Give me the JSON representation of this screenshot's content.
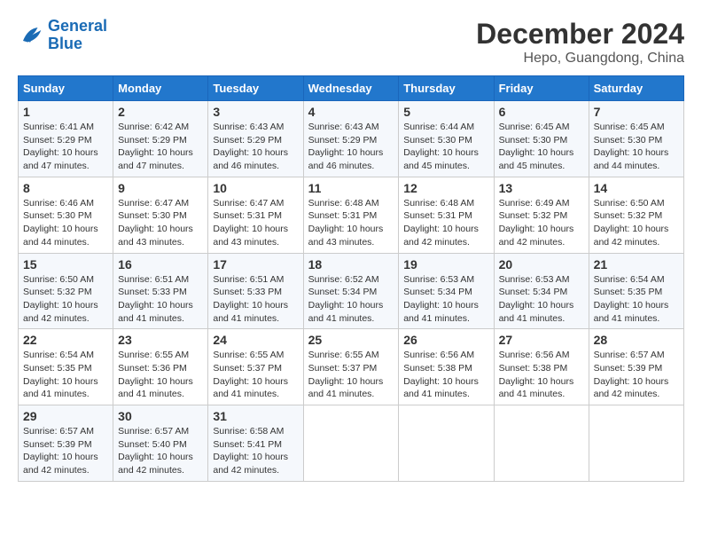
{
  "logo": {
    "line1": "General",
    "line2": "Blue"
  },
  "title": "December 2024",
  "location": "Hepo, Guangdong, China",
  "header": {
    "days": [
      "Sunday",
      "Monday",
      "Tuesday",
      "Wednesday",
      "Thursday",
      "Friday",
      "Saturday"
    ]
  },
  "weeks": [
    [
      {
        "day": "1",
        "sunrise": "6:41 AM",
        "sunset": "5:29 PM",
        "daylight": "10 hours and 47 minutes."
      },
      {
        "day": "2",
        "sunrise": "6:42 AM",
        "sunset": "5:29 PM",
        "daylight": "10 hours and 47 minutes."
      },
      {
        "day": "3",
        "sunrise": "6:43 AM",
        "sunset": "5:29 PM",
        "daylight": "10 hours and 46 minutes."
      },
      {
        "day": "4",
        "sunrise": "6:43 AM",
        "sunset": "5:29 PM",
        "daylight": "10 hours and 46 minutes."
      },
      {
        "day": "5",
        "sunrise": "6:44 AM",
        "sunset": "5:30 PM",
        "daylight": "10 hours and 45 minutes."
      },
      {
        "day": "6",
        "sunrise": "6:45 AM",
        "sunset": "5:30 PM",
        "daylight": "10 hours and 45 minutes."
      },
      {
        "day": "7",
        "sunrise": "6:45 AM",
        "sunset": "5:30 PM",
        "daylight": "10 hours and 44 minutes."
      }
    ],
    [
      {
        "day": "8",
        "sunrise": "6:46 AM",
        "sunset": "5:30 PM",
        "daylight": "10 hours and 44 minutes."
      },
      {
        "day": "9",
        "sunrise": "6:47 AM",
        "sunset": "5:30 PM",
        "daylight": "10 hours and 43 minutes."
      },
      {
        "day": "10",
        "sunrise": "6:47 AM",
        "sunset": "5:31 PM",
        "daylight": "10 hours and 43 minutes."
      },
      {
        "day": "11",
        "sunrise": "6:48 AM",
        "sunset": "5:31 PM",
        "daylight": "10 hours and 43 minutes."
      },
      {
        "day": "12",
        "sunrise": "6:48 AM",
        "sunset": "5:31 PM",
        "daylight": "10 hours and 42 minutes."
      },
      {
        "day": "13",
        "sunrise": "6:49 AM",
        "sunset": "5:32 PM",
        "daylight": "10 hours and 42 minutes."
      },
      {
        "day": "14",
        "sunrise": "6:50 AM",
        "sunset": "5:32 PM",
        "daylight": "10 hours and 42 minutes."
      }
    ],
    [
      {
        "day": "15",
        "sunrise": "6:50 AM",
        "sunset": "5:32 PM",
        "daylight": "10 hours and 42 minutes."
      },
      {
        "day": "16",
        "sunrise": "6:51 AM",
        "sunset": "5:33 PM",
        "daylight": "10 hours and 41 minutes."
      },
      {
        "day": "17",
        "sunrise": "6:51 AM",
        "sunset": "5:33 PM",
        "daylight": "10 hours and 41 minutes."
      },
      {
        "day": "18",
        "sunrise": "6:52 AM",
        "sunset": "5:34 PM",
        "daylight": "10 hours and 41 minutes."
      },
      {
        "day": "19",
        "sunrise": "6:53 AM",
        "sunset": "5:34 PM",
        "daylight": "10 hours and 41 minutes."
      },
      {
        "day": "20",
        "sunrise": "6:53 AM",
        "sunset": "5:34 PM",
        "daylight": "10 hours and 41 minutes."
      },
      {
        "day": "21",
        "sunrise": "6:54 AM",
        "sunset": "5:35 PM",
        "daylight": "10 hours and 41 minutes."
      }
    ],
    [
      {
        "day": "22",
        "sunrise": "6:54 AM",
        "sunset": "5:35 PM",
        "daylight": "10 hours and 41 minutes."
      },
      {
        "day": "23",
        "sunrise": "6:55 AM",
        "sunset": "5:36 PM",
        "daylight": "10 hours and 41 minutes."
      },
      {
        "day": "24",
        "sunrise": "6:55 AM",
        "sunset": "5:37 PM",
        "daylight": "10 hours and 41 minutes."
      },
      {
        "day": "25",
        "sunrise": "6:55 AM",
        "sunset": "5:37 PM",
        "daylight": "10 hours and 41 minutes."
      },
      {
        "day": "26",
        "sunrise": "6:56 AM",
        "sunset": "5:38 PM",
        "daylight": "10 hours and 41 minutes."
      },
      {
        "day": "27",
        "sunrise": "6:56 AM",
        "sunset": "5:38 PM",
        "daylight": "10 hours and 41 minutes."
      },
      {
        "day": "28",
        "sunrise": "6:57 AM",
        "sunset": "5:39 PM",
        "daylight": "10 hours and 42 minutes."
      }
    ],
    [
      {
        "day": "29",
        "sunrise": "6:57 AM",
        "sunset": "5:39 PM",
        "daylight": "10 hours and 42 minutes."
      },
      {
        "day": "30",
        "sunrise": "6:57 AM",
        "sunset": "5:40 PM",
        "daylight": "10 hours and 42 minutes."
      },
      {
        "day": "31",
        "sunrise": "6:58 AM",
        "sunset": "5:41 PM",
        "daylight": "10 hours and 42 minutes."
      },
      null,
      null,
      null,
      null
    ]
  ]
}
